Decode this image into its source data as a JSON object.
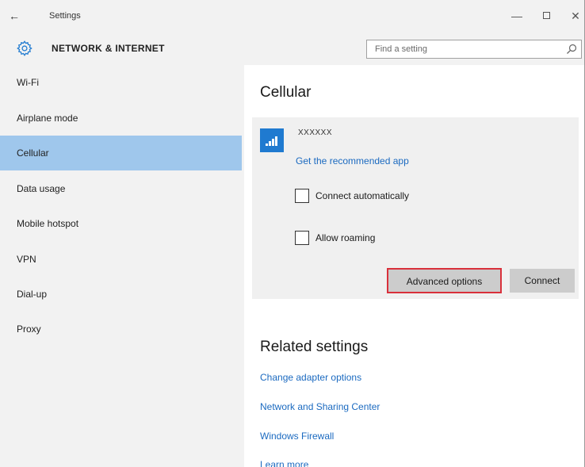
{
  "window": {
    "title": "Settings",
    "back_glyph": "←",
    "minimize_glyph": "—",
    "close_glyph": "✕"
  },
  "header": {
    "icon": "gear-icon",
    "title": "NETWORK & INTERNET",
    "search_placeholder": "Find a setting"
  },
  "sidebar": {
    "items": [
      {
        "label": "Wi-Fi",
        "active": false
      },
      {
        "label": "Airplane mode",
        "active": false
      },
      {
        "label": "Cellular",
        "active": true
      },
      {
        "label": "Data usage",
        "active": false
      },
      {
        "label": "Mobile hotspot",
        "active": false
      },
      {
        "label": "VPN",
        "active": false
      },
      {
        "label": "Dial-up",
        "active": false
      },
      {
        "label": "Proxy",
        "active": false
      }
    ]
  },
  "main": {
    "heading": "Cellular",
    "network": {
      "icon": "cellular-signal-icon",
      "name": "XXXXXX",
      "recommended_app_link": "Get the recommended app",
      "connect_automatically": {
        "label": "Connect automatically",
        "checked": false
      },
      "allow_roaming": {
        "label": "Allow roaming",
        "checked": false
      },
      "advanced_button": "Advanced options",
      "connect_button": "Connect"
    },
    "related": {
      "heading": "Related settings",
      "links": [
        "Change adapter options",
        "Network and Sharing Center",
        "Windows Firewall",
        "Learn more"
      ]
    }
  },
  "colors": {
    "accent": "#1f7ad0",
    "link": "#1b6ac0",
    "selected_nav": "#9fc7ec",
    "highlight_border": "#d9303b"
  }
}
